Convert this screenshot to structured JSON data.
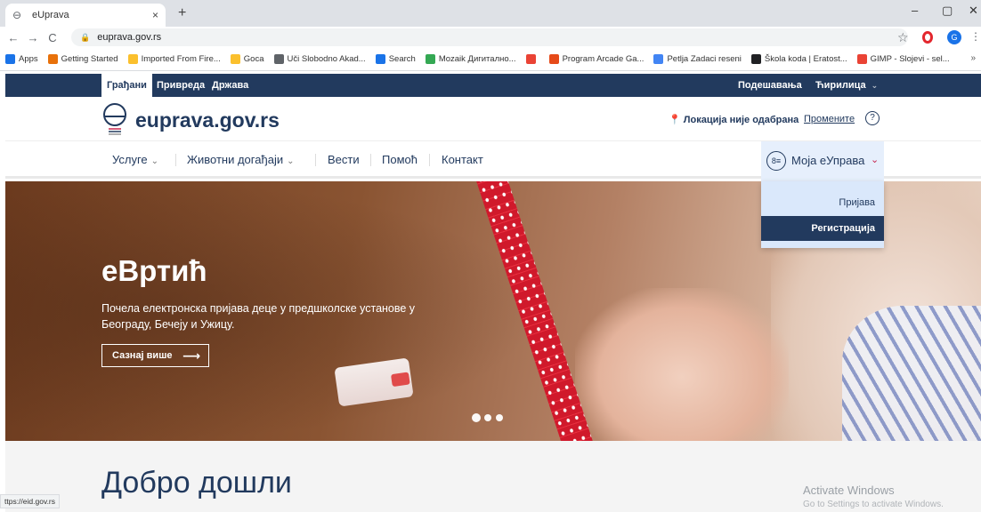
{
  "browser": {
    "tab_title": "eUprava",
    "tab_close": "×",
    "new_tab": "+",
    "url": "euprava.gov.rs",
    "window_controls": {
      "minimize": "–",
      "maximize": "▢",
      "close": "✕"
    },
    "nav": {
      "back": "←",
      "forward": "→",
      "reload": "C"
    },
    "profile_initial": "G",
    "bookmarks": [
      {
        "label": "Apps",
        "color": "#1a73e8"
      },
      {
        "label": "Getting Started",
        "color": "#e8710a"
      },
      {
        "label": "Imported From Fire...",
        "color": "#fbc02d"
      },
      {
        "label": "Goca",
        "color": "#fbc02d"
      },
      {
        "label": "Uči Slobodno Akad...",
        "color": "#5f6368"
      },
      {
        "label": "Search",
        "color": "#1a73e8"
      },
      {
        "label": "Mozaik Дигитално...",
        "color": "#34a853"
      },
      {
        "label": "",
        "color": "#ea4335"
      },
      {
        "label": "Program Arcade Ga...",
        "color": "#e64a19"
      },
      {
        "label": "Petlja Zadaci reseni",
        "color": "#4285f4"
      },
      {
        "label": "Škola koda | Eratost...",
        "color": "#202124"
      },
      {
        "label": "GIMP - Slojevi - sel...",
        "color": "#ea4335"
      }
    ],
    "bookmarks_more": "»",
    "status_url": "ttps://eid.gov.rs"
  },
  "site": {
    "topbar": {
      "links": [
        "Грађани",
        "Привреда",
        "Држава"
      ],
      "settings": "Подешавања",
      "script": "Ћирилица"
    },
    "brand": "euprava.gov.rs",
    "location": {
      "text": "Локација није одабрана",
      "change": "Промените",
      "help": "?"
    },
    "nav": {
      "items": [
        "Услуге",
        "Животни догађаји",
        "Вести",
        "Помоћ",
        "Контакт"
      ],
      "my_account": "Моја еУправа"
    },
    "dropdown": {
      "login": "Пријава",
      "register": "Регистрација"
    },
    "hero": {
      "title": "еВртић",
      "text": "Почела електронска пријава деце у предшколске установе у Београду, Бечеју и Ужицу.",
      "button": "Сазнај више"
    },
    "welcome": "Добро дошли",
    "watermark": {
      "line1": "Activate Windows",
      "line2": "Go to Settings to activate Windows."
    }
  },
  "colors": {
    "navy": "#223a5e",
    "accent_red": "#c7254e",
    "dropdown_bg": "#dae8fb"
  }
}
